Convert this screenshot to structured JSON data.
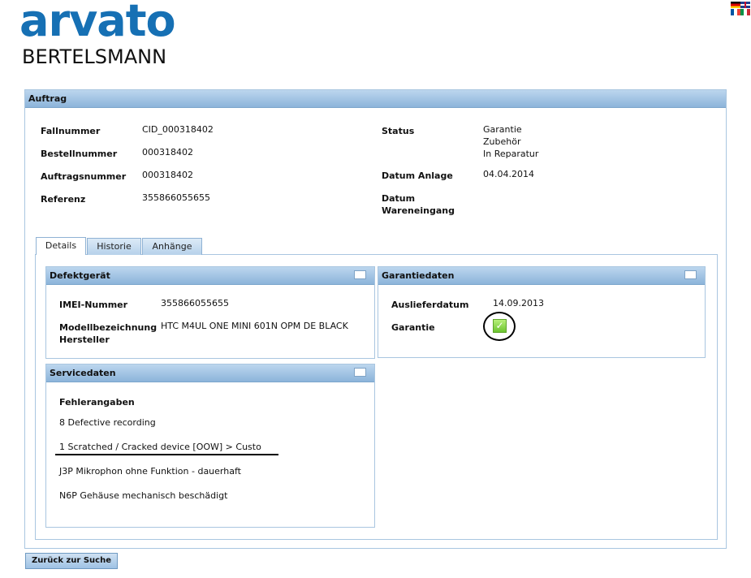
{
  "brand": {
    "top": "arvato",
    "bottom": "BERTELSMANN"
  },
  "flags": [
    "de-flag-icon",
    "uk-flag-icon",
    "fr-flag-icon",
    "it-flag-icon"
  ],
  "auftrag": {
    "title": "Auftrag",
    "fallnummer_label": "Fallnummer",
    "fallnummer": "CID_000318402",
    "bestellnummer_label": "Bestellnummer",
    "bestellnummer": "000318402",
    "auftragsnummer_label": "Auftragsnummer",
    "auftragsnummer": "000318402",
    "referenz_label": "Referenz",
    "referenz": "355866055655",
    "status_label": "Status",
    "status": [
      "Garantie",
      "Zubehör",
      "In Reparatur"
    ],
    "datum_anlage_label": "Datum Anlage",
    "datum_anlage": "04.04.2014",
    "datum_wareneingang_label": [
      "Datum",
      "Wareneingang"
    ]
  },
  "tabs": [
    {
      "label": "Details",
      "active": true
    },
    {
      "label": "Historie",
      "active": false
    },
    {
      "label": "Anhänge",
      "active": false
    }
  ],
  "defektgeraet": {
    "title": "Defektgerät",
    "imei_label": "IMEI-Nummer",
    "imei": "355866055655",
    "modell_label": "Modellbezeichnung",
    "modell": "HTC M4UL ONE MINI 601N OPM DE BLACK",
    "hersteller_label": "Hersteller"
  },
  "garantiedaten": {
    "title": "Garantiedaten",
    "auslieferdatum_label": "Auslieferdatum",
    "auslieferdatum": "14.09.2013",
    "garantie_label": "Garantie",
    "garantie_checked": true
  },
  "servicedaten": {
    "title": "Servicedaten",
    "fehlerangaben_label": "Fehlerangaben",
    "errors": [
      "8 Defective recording",
      "1 Scratched / Cracked device [OOW] > Custo",
      "J3P Mikrophon ohne Funktion - dauerhaft",
      "N6P Gehäuse mechanisch beschädigt"
    ]
  },
  "buttons": {
    "back": "Zurück zur Suche"
  }
}
